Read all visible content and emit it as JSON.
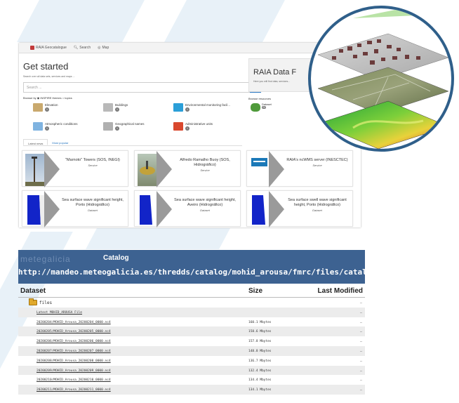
{
  "geocatalogue": {
    "nav": [
      {
        "label": "RAIA Geocatalogue",
        "icon": "brand-icon"
      },
      {
        "label": "Search",
        "icon": "search-icon"
      },
      {
        "label": "Map",
        "icon": "globe-icon"
      }
    ],
    "title": "Get started",
    "subtitle": "Search over all data sets, services and maps ...",
    "search": {
      "placeholder": "Search ..."
    },
    "browse_label": "Browse by ◉ INSPIRE themes ○ topics",
    "themes": [
      {
        "label": "Elevation",
        "count": "1",
        "color": "#c9a96e"
      },
      {
        "label": "Buildings",
        "count": "1",
        "color": "#b9b9b9"
      },
      {
        "label": "Environmental monitoring facil...",
        "count": "1",
        "color": "#2b9fd8"
      },
      {
        "label": "Atmospheric conditions",
        "count": "1",
        "color": "#7fb3e0"
      },
      {
        "label": "Geographical names",
        "count": "1",
        "color": "#b0b0b0"
      },
      {
        "label": "Administrative units",
        "count": "1",
        "color": "#d9482e"
      }
    ],
    "tabs": [
      "Latest news",
      "Most popular"
    ],
    "raia": {
      "title": "RAIA Data F",
      "subtitle": "Here you will find data, services..."
    },
    "browse_resources": "Browse resources",
    "resources": [
      {
        "label": "Dataset",
        "count": "24",
        "color": "#4f9a3a"
      }
    ],
    "cards": [
      {
        "title": "\"Marnoto\" Towers (SOS, INEGI)",
        "kind": "Service",
        "thumb": "tower"
      },
      {
        "title": "Alfredo Ramalho Buoy (SOS, Hidrográfico)",
        "kind": "Service",
        "thumb": "buoy"
      },
      {
        "title": "RAIA's ncWMS server (INESCTEC)",
        "kind": "Service",
        "thumb": "logo"
      },
      {
        "title": "Sea surface wave significant height, Porto (Hidrográfico)",
        "kind": "Dataset",
        "thumb": "map"
      },
      {
        "title": "Sea surface wave significant height, Aveiro (Hidrográfico)",
        "kind": "Dataset",
        "thumb": "map"
      },
      {
        "title": "Sea surface swell wave significant height, Porto (Hidrográfico)",
        "kind": "Dataset",
        "thumb": "map"
      }
    ]
  },
  "catalog": {
    "logo": "metegalicia",
    "label": "Catalog",
    "url": "http://mandeo.meteogalicia.es/thredds/catalog/mohid_arousa/fmrc/files/catalog.htm",
    "columns": {
      "dataset": "Dataset",
      "size": "Size",
      "modified": "Last Modified"
    },
    "folder": {
      "name": "files",
      "modified": "--"
    },
    "rows": [
      {
        "name": "Latest MOHID_AROUSA File",
        "size": "",
        "modified": "--"
      },
      {
        "name": "20200204/MOHID_Arousa_20200204_0000.nc4",
        "size": "160.1 Mbytes",
        "modified": "--"
      },
      {
        "name": "20200205/MOHID_Arousa_20200205_0000.nc4",
        "size": "158.6 Mbytes",
        "modified": "--"
      },
      {
        "name": "20200206/MOHID_Arousa_20200206_0000.nc4",
        "size": "157.8 Mbytes",
        "modified": "--"
      },
      {
        "name": "20200207/MOHID_Arousa_20200207_0000.nc4",
        "size": "148.8 Mbytes",
        "modified": "--"
      },
      {
        "name": "20200208/MOHID_Arousa_20200208_0000.nc4",
        "size": "136.7 Mbytes",
        "modified": "--"
      },
      {
        "name": "20200209/MOHID_Arousa_20200209_0000.nc4",
        "size": "132.4 Mbytes",
        "modified": "--"
      },
      {
        "name": "20200210/MOHID_Arousa_20200210_0000.nc4",
        "size": "134.4 Mbytes",
        "modified": "--"
      },
      {
        "name": "20200211/MOHID_Arousa_20200211_0000.nc4",
        "size": "134.1 Mbytes",
        "modified": "--"
      }
    ]
  },
  "layers_illustration": {
    "layers": [
      "buildings",
      "imagery",
      "elevation"
    ]
  }
}
